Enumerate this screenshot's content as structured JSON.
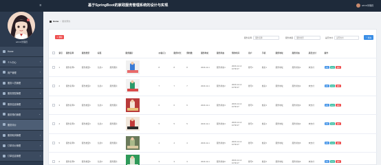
{
  "header": {
    "menu_icon": "hamburger-icon",
    "title": "基于SpringBoot的家政服务管理系统的设计与实现",
    "username": "admin管理员"
  },
  "sidebar": {
    "role_label": "admin管理员",
    "items": [
      {
        "label": "Home",
        "active": false
      },
      {
        "label": "个人中心",
        "active": false
      },
      {
        "label": "用户管理",
        "active": false
      },
      {
        "label": "服务人员管理",
        "active": false
      },
      {
        "label": "服务类型管理",
        "active": false
      },
      {
        "label": "服务信息管理",
        "active": false
      },
      {
        "label": "服务预约管理",
        "active": false
      },
      {
        "label": "服务评价",
        "active": true
      },
      {
        "label": "服务取消管理",
        "active": false
      },
      {
        "label": "订单评价管理",
        "active": false
      },
      {
        "label": "订单信息管理",
        "active": false
      }
    ]
  },
  "breadcrumb": {
    "home": "Home",
    "current": "服务预约"
  },
  "toolbar": {
    "delete_label": "删除",
    "search_label": "查询",
    "filters": [
      {
        "label": "服务名称",
        "placeholder": "服务名称"
      },
      {
        "label": "服务类型",
        "placeholder": "服务类型"
      },
      {
        "label": "是否支付",
        "placeholder": "是否支付"
      }
    ]
  },
  "table": {
    "columns": [
      "索引",
      "服务名称",
      "服务类型",
      "标签",
      "服务图片",
      "价格(元)",
      "服务时长",
      "预约数",
      "服务地址",
      "服务状态",
      "预约时间",
      "用户",
      "手机",
      "服务地址",
      "服务状态",
      "是否支付",
      "操作"
    ],
    "rows": [
      {
        "index": "1",
        "name": "服务名称1",
        "type": "服务类型1",
        "tag": "信息1",
        "img": "服务图片",
        "price": "8",
        "duration": "8",
        "count": "8",
        "address": "2023-12-1",
        "status": "服务状态1",
        "time": "2023-12-12 16:50:27",
        "user": "账号1",
        "phone": "姓名1",
        "svc_addr": "服务地址",
        "svc_status": "服务状态1",
        "paid": "未支付"
      },
      {
        "index": "2",
        "name": "服务名称2",
        "type": "服务类型2",
        "tag": "信息2",
        "img": "服务图片",
        "price": "7",
        "duration": "7",
        "count": "7",
        "address": "2023-12-1",
        "status": "服务状态2",
        "time": "2023-12-12 16:50:27",
        "user": "账号2",
        "phone": "姓名2",
        "svc_addr": "服务地址",
        "svc_status": "服务状态2",
        "paid": "未支付"
      },
      {
        "index": "3",
        "name": "服务名称3",
        "type": "服务类型3",
        "tag": "信息3",
        "img": "服务图片",
        "price": "6",
        "duration": "6",
        "count": "6",
        "address": "2023-12-1",
        "status": "服务状态3",
        "time": "2023-12-12 16:50:27",
        "user": "账号3",
        "phone": "姓名3",
        "svc_addr": "服务地址",
        "svc_status": "服务状态3",
        "paid": "未支付"
      },
      {
        "index": "4",
        "name": "服务名称4",
        "type": "服务类型4",
        "tag": "信息4",
        "img": "服务图片",
        "price": "5",
        "duration": "5",
        "count": "5",
        "address": "2023-12-1",
        "status": "服务状态4",
        "time": "2023-12-12 16:50:27",
        "user": "账号4",
        "phone": "姓名4",
        "svc_addr": "服务地址",
        "svc_status": "服务状态4",
        "paid": "未支付"
      },
      {
        "index": "5",
        "name": "服务名称5",
        "type": "服务类型5",
        "tag": "信息5",
        "img": "服务图片",
        "price": "4",
        "duration": "4",
        "count": "4",
        "address": "2023-12-1",
        "status": "服务状态5",
        "time": "2023-12-12 16:50:27",
        "user": "账号5",
        "phone": "姓名5",
        "svc_addr": "服务地址",
        "svc_status": "服务状态5",
        "paid": "未支付"
      },
      {
        "index": "6",
        "name": "服务名称6",
        "type": "服务类型6",
        "tag": "信息6",
        "img": "服务图片",
        "price": "3",
        "duration": "3",
        "count": "3",
        "address": "2023-12-1",
        "status": "服务状态6",
        "time": "2023-12-12 16:50:27",
        "user": "账号6",
        "phone": "姓名6",
        "svc_addr": "服务地址",
        "svc_status": "服务状态6",
        "paid": "未支付"
      }
    ],
    "ops": {
      "detail": "详情",
      "edit": "修改",
      "del": "删除"
    }
  },
  "colors": {
    "header": "#1e2a3a",
    "sidebar": "#2c3a4e",
    "primary": "#3a8ee6",
    "danger": "#ee4e4e",
    "success": "#2fb89f"
  }
}
